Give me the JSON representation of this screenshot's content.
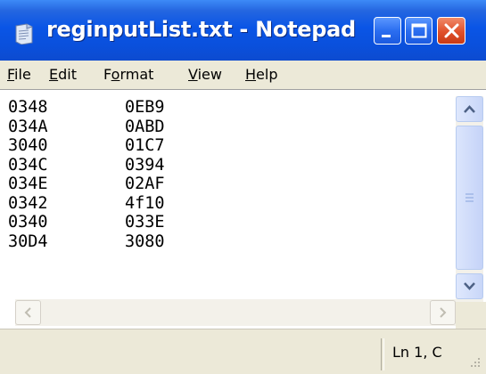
{
  "window": {
    "title": "reginputList.txt - Notepad",
    "app_icon": "notepad-icon",
    "controls": [
      "minimize-icon",
      "maximize-icon",
      "close-icon"
    ]
  },
  "menu": {
    "file": {
      "ul": "F",
      "rest": "ile"
    },
    "edit": {
      "ul": "E",
      "rest": "dit"
    },
    "format": {
      "pre": "F",
      "ul": "o",
      "rest": "rmat"
    },
    "view": {
      "ul": "V",
      "rest": "iew"
    },
    "help": {
      "ul": "H",
      "rest": "elp"
    }
  },
  "document": {
    "rows": [
      {
        "a": "0348",
        "b": "0EB9"
      },
      {
        "a": "034A",
        "b": "0ABD"
      },
      {
        "a": "3040",
        "b": "01C7"
      },
      {
        "a": "034C",
        "b": "0394"
      },
      {
        "a": "034E",
        "b": "02AF"
      },
      {
        "a": "0342",
        "b": "4f10"
      },
      {
        "a": "0340",
        "b": "033E"
      },
      {
        "a": "30D4",
        "b": "3080"
      }
    ]
  },
  "status": {
    "position": "Ln 1, C"
  },
  "colors": {
    "titlebar": "#0a55e6",
    "menubar": "#ece9d8",
    "close_button": "#e0502a"
  }
}
